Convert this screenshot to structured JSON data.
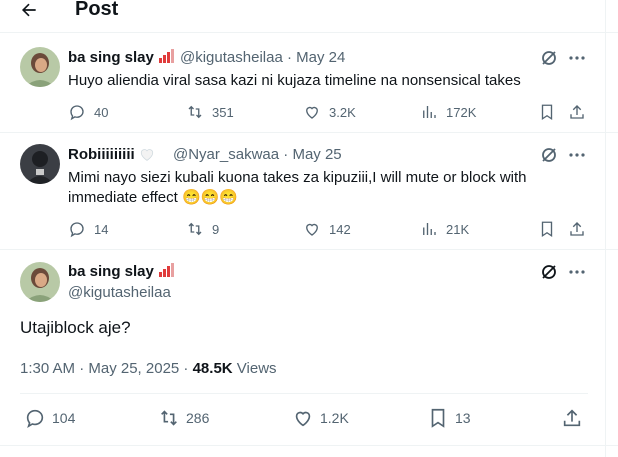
{
  "header": {
    "title": "Post"
  },
  "replies": [
    {
      "name": "ba sing slay",
      "handle": "@kigutasheilaa",
      "sep": "·",
      "date": "May 24",
      "text": "Huyo aliendia viral sasa kazi ni kujaza timeline na nonsensical takes",
      "replies": "40",
      "retweets": "351",
      "likes": "3.2K",
      "views": "172K"
    },
    {
      "name": "Robiiiiiiiii",
      "handle": "@Nyar_sakwaa",
      "sep": "·",
      "date": "May 25",
      "text": "Mimi nayo siezi kubali kuona takes za kipuziii,I will mute or block with immediate effect 😁😁😁",
      "replies": "14",
      "retweets": "9",
      "likes": "142",
      "views": "21K"
    }
  ],
  "main": {
    "name": "ba sing slay",
    "handle": "@kigutasheilaa",
    "text": "Utajiblock aje?",
    "timestamp": "1:30 AM · May 25, 2025 · ",
    "views_count": "48.5K",
    "views_label": " Views",
    "replies": "104",
    "retweets": "286",
    "likes": "1.2K",
    "bookmarks": "13"
  },
  "colors": {
    "text": "#0f1419",
    "secondary": "#536471",
    "divider": "#eff3f4"
  },
  "icons": [
    "back-arrow-icon",
    "grok-icon",
    "more-icon",
    "reply-icon",
    "retweet-icon",
    "like-icon",
    "views-icon",
    "bookmark-icon",
    "share-icon",
    "white-heart-icon",
    "signal-bars-emoji-icon"
  ]
}
